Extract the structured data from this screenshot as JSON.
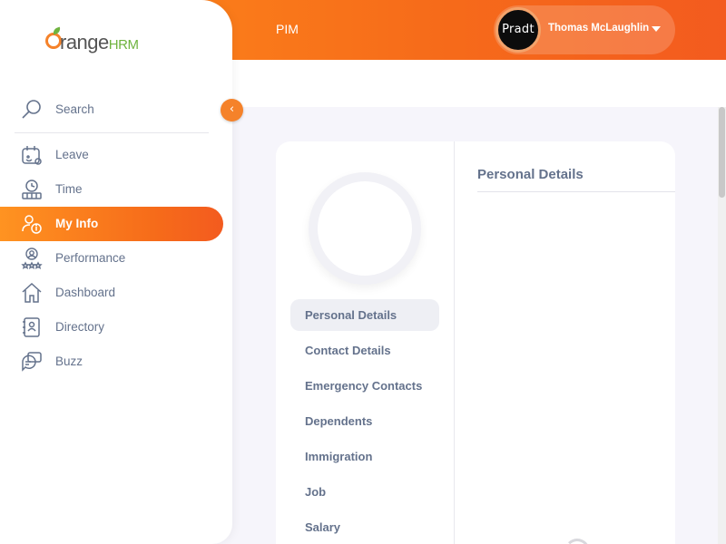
{
  "topbar": {
    "title": "PIM",
    "user": {
      "avatar_text": "Pradt",
      "name": "Thomas McLaughlin"
    }
  },
  "sidebar": {
    "brand": {
      "name_part1": "range",
      "name_part2": "HRM"
    },
    "search_label": "Search",
    "items": [
      {
        "label": "Leave",
        "icon": "leave-icon"
      },
      {
        "label": "Time",
        "icon": "time-icon"
      },
      {
        "label": "My Info",
        "icon": "my-info-icon",
        "active": true
      },
      {
        "label": "Performance",
        "icon": "performance-icon"
      },
      {
        "label": "Dashboard",
        "icon": "dashboard-icon"
      },
      {
        "label": "Directory",
        "icon": "directory-icon"
      },
      {
        "label": "Buzz",
        "icon": "buzz-icon"
      }
    ]
  },
  "profile": {
    "tabs": [
      {
        "label": "Personal Details",
        "active": true
      },
      {
        "label": "Contact Details"
      },
      {
        "label": "Emergency Contacts"
      },
      {
        "label": "Dependents"
      },
      {
        "label": "Immigration"
      },
      {
        "label": "Job"
      },
      {
        "label": "Salary"
      }
    ],
    "section_title": "Personal Details"
  },
  "colors": {
    "accent": "#f66b1a",
    "brand_green": "#6fb33f",
    "text": "#64728c"
  }
}
